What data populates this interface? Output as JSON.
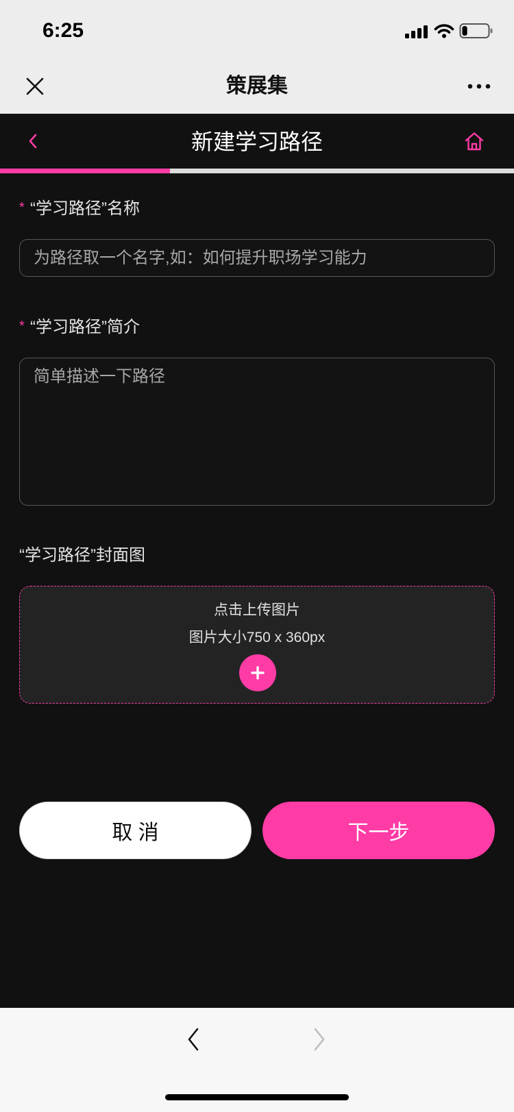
{
  "status_bar": {
    "time": "6:25",
    "signal_icon": "cellular-signal-icon",
    "wifi_icon": "wifi-icon",
    "battery_icon": "battery-icon",
    "battery_level": 0.2
  },
  "webview_nav": {
    "title": "策展集",
    "close_icon": "close-icon",
    "more_icon": "more-icon"
  },
  "page_header": {
    "title": "新建学习路径",
    "back_icon": "chevron-left-icon",
    "home_icon": "home-icon"
  },
  "progress": {
    "fraction": 0.33
  },
  "form": {
    "name": {
      "required_mark": "*",
      "label": "“学习路径”名称",
      "placeholder": "为路径取一个名字,如：如何提升职场学习能力",
      "value": ""
    },
    "intro": {
      "required_mark": "*",
      "label": "“学习路径”简介",
      "placeholder": "简单描述一下路径",
      "value": ""
    },
    "cover": {
      "label": "“学习路径”封面图",
      "upload_hint": "点击上传图片",
      "size_hint": "图片大小750 x 360px",
      "add_icon": "plus-icon"
    }
  },
  "actions": {
    "cancel_label": "取 消",
    "next_label": "下一步"
  },
  "browser_toolbar": {
    "back_icon": "chevron-left-icon",
    "forward_icon": "chevron-right-icon",
    "forward_enabled": false
  },
  "colors": {
    "accent": "#ff3ba5",
    "page_background": "#111111",
    "chrome_background": "#ededed",
    "progress_track": "#dcdcdc",
    "upload_background": "#232323"
  }
}
